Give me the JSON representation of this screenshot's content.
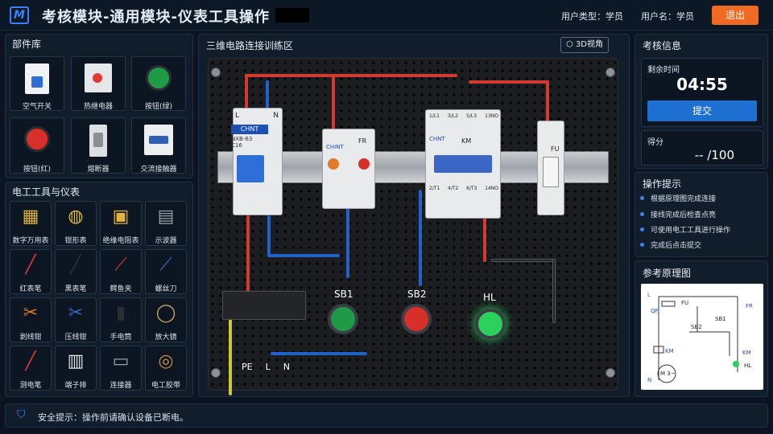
{
  "header": {
    "title": "考核模块-通用模块-仪表工具操作",
    "user_type": "用户类型：学员",
    "user_name": "用户名：学员",
    "logout": "退出"
  },
  "parts_library": {
    "title": "部件库",
    "items": [
      {
        "label": "空气开关",
        "icon": "air-switch-icon"
      },
      {
        "label": "热继电器",
        "icon": "thermal-relay-icon"
      },
      {
        "label": "按钮(绿)",
        "icon": "green-button-icon"
      },
      {
        "label": "按钮(红)",
        "icon": "red-button-icon"
      },
      {
        "label": "熔断器",
        "icon": "fuse-icon"
      },
      {
        "label": "交流接触器",
        "icon": "contactor-icon"
      }
    ]
  },
  "tools": {
    "title": "电工工具与仪表",
    "items": [
      {
        "label": "数字万用表",
        "icon": "multimeter-icon"
      },
      {
        "label": "钳形表",
        "icon": "clamp-meter-icon"
      },
      {
        "label": "绝缘电阻表",
        "icon": "megohmmeter-icon"
      },
      {
        "label": "示波器",
        "icon": "oscilloscope-icon"
      },
      {
        "label": "红表笔",
        "icon": "red-probe-icon"
      },
      {
        "label": "黑表笔",
        "icon": "black-probe-icon"
      },
      {
        "label": "鳄鱼夹",
        "icon": "alligator-clip-icon"
      },
      {
        "label": "螺丝刀",
        "icon": "screwdriver-icon"
      },
      {
        "label": "剥线钳",
        "icon": "wire-stripper-icon"
      },
      {
        "label": "压线钳",
        "icon": "crimper-icon"
      },
      {
        "label": "手电筒",
        "icon": "flashlight-icon"
      },
      {
        "label": "放大镜",
        "icon": "magnifier-icon"
      },
      {
        "label": "测电笔",
        "icon": "voltage-pen-icon"
      },
      {
        "label": "端子排",
        "icon": "terminal-block-icon"
      },
      {
        "label": "连接器",
        "icon": "connector-icon"
      },
      {
        "label": "电工胶带",
        "icon": "tape-icon"
      }
    ]
  },
  "workspace": {
    "title": "三维电路连接训练区",
    "view_button": "3D视角",
    "devices": {
      "breaker_brand": "CHNT",
      "breaker_model": "NXB-63",
      "breaker_rating": "C16",
      "breaker_l": "L",
      "breaker_n": "N",
      "relay_label": "FR",
      "relay_brand": "CHINT",
      "contactor_label": "KM",
      "contactor_brand": "CHNT",
      "contactor_top": [
        "1/L1",
        "3/L2",
        "5/L3",
        "13NO"
      ],
      "contactor_bottom": [
        "2/T1",
        "4/T2",
        "6/T3",
        "14NO"
      ],
      "fuse_label": "FU",
      "terminal_labels": [
        "PE",
        "L",
        "N"
      ],
      "sb1": "SB1",
      "sb2": "SB2",
      "hl": "HL"
    }
  },
  "exam": {
    "title": "考核信息",
    "remaining_label": "剩余时间",
    "time": "04:55",
    "submit": "提交",
    "score_label": "得分",
    "score": "-- /100"
  },
  "hints": {
    "title": "操作提示",
    "items": [
      "根据原理图完成连接",
      "接线完成后检查点亮",
      "可使用电工工具进行操作",
      "完成后点击提交"
    ]
  },
  "schematic": {
    "title": "参考原理图",
    "labels": [
      "L",
      "QF",
      "FU",
      "FR",
      "SB2",
      "SB1",
      "KM",
      "KM",
      "HL",
      "N",
      "M 3~"
    ]
  },
  "footer": {
    "safety": "安全提示：操作前请确认设备已断电。"
  },
  "colors": {
    "accent": "#3b82f6",
    "logout": "#f06a22",
    "submit": "#1d6fd1"
  }
}
